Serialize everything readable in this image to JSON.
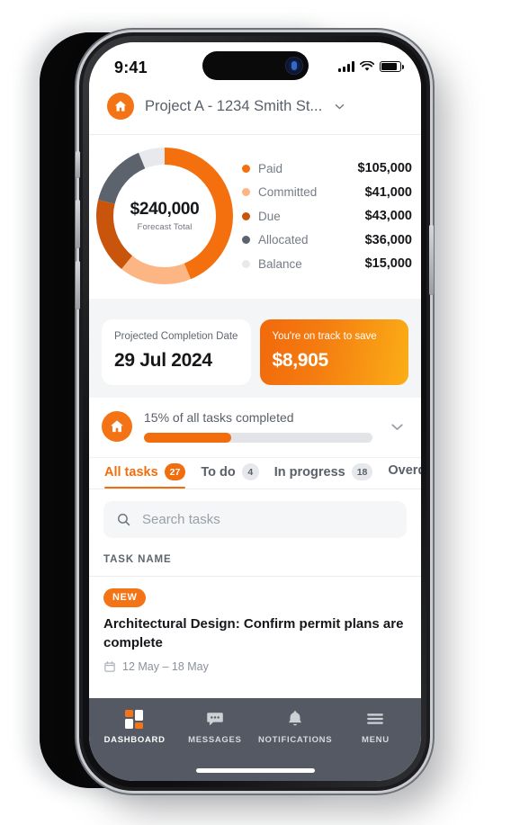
{
  "device": {
    "status_bar": {
      "time": "9:41",
      "signal_icon": "cellular-bars-icon",
      "wifi_icon": "wifi-icon",
      "battery_icon": "battery-icon"
    },
    "home_indicator": "home-indicator"
  },
  "header": {
    "home_icon": "home-icon",
    "project_name": "Project A - 1234 Smith St...",
    "chevron_icon": "chevron-down-icon"
  },
  "chart_data": {
    "type": "pie",
    "title": "Forecast Total",
    "center_value": "$240,000",
    "center_label": "Forecast Total",
    "total": 240000,
    "categories": [
      "Paid",
      "Committed",
      "Due",
      "Allocated",
      "Balance"
    ],
    "values": [
      105000,
      41000,
      43000,
      36000,
      15000
    ],
    "value_labels": [
      "$105,000",
      "$41,000",
      "$43,000",
      "$36,000",
      "$15,000"
    ],
    "colors": [
      "#F4700E",
      "#FBB683",
      "#C9540B",
      "#5C636D",
      "#E7E9EC"
    ],
    "legend_position": "right",
    "donut": true,
    "start_angle_deg": 0,
    "direction": "clockwise"
  },
  "stat_cards": [
    {
      "label": "Projected Completion Date",
      "value": "29 Jul 2024",
      "style": "light"
    },
    {
      "label": "You're on track to save",
      "value": "$8,905",
      "style": "accent"
    }
  ],
  "progress": {
    "home_icon": "home-icon",
    "text": "15% of all tasks completed",
    "percent": 15,
    "fill_width_pct": 38,
    "expand_icon": "chevron-down-icon"
  },
  "tabs": [
    {
      "label": "All tasks",
      "count": "27",
      "active": true
    },
    {
      "label": "To do",
      "count": "4",
      "active": false
    },
    {
      "label": "In progress",
      "count": "18",
      "active": false
    },
    {
      "label": "Overdue",
      "count": "",
      "active": false
    }
  ],
  "search": {
    "icon": "search-icon",
    "placeholder": "Search tasks",
    "value": ""
  },
  "task_list": {
    "column_header": "TASK NAME",
    "items": [
      {
        "badge": "NEW",
        "title": "Architectural Design: Confirm permit plans are complete",
        "calendar_icon": "calendar-icon",
        "dates": "12 May – 18 May"
      }
    ]
  },
  "bottom_nav": [
    {
      "label": "DASHBOARD",
      "icon": "dashboard-grid-icon",
      "active": true
    },
    {
      "label": "MESSAGES",
      "icon": "chat-bubble-icon",
      "active": false
    },
    {
      "label": "NOTIFICATIONS",
      "icon": "bell-icon",
      "active": false
    },
    {
      "label": "MENU",
      "icon": "hamburger-menu-icon",
      "active": false
    }
  ],
  "theme": {
    "accent": "#F26D0D",
    "accent_light": "#FBAE17",
    "nav_background": "#545963",
    "page_background": "#f4f5f7",
    "text_dark": "#15171a",
    "text_muted": "#5a6069"
  }
}
